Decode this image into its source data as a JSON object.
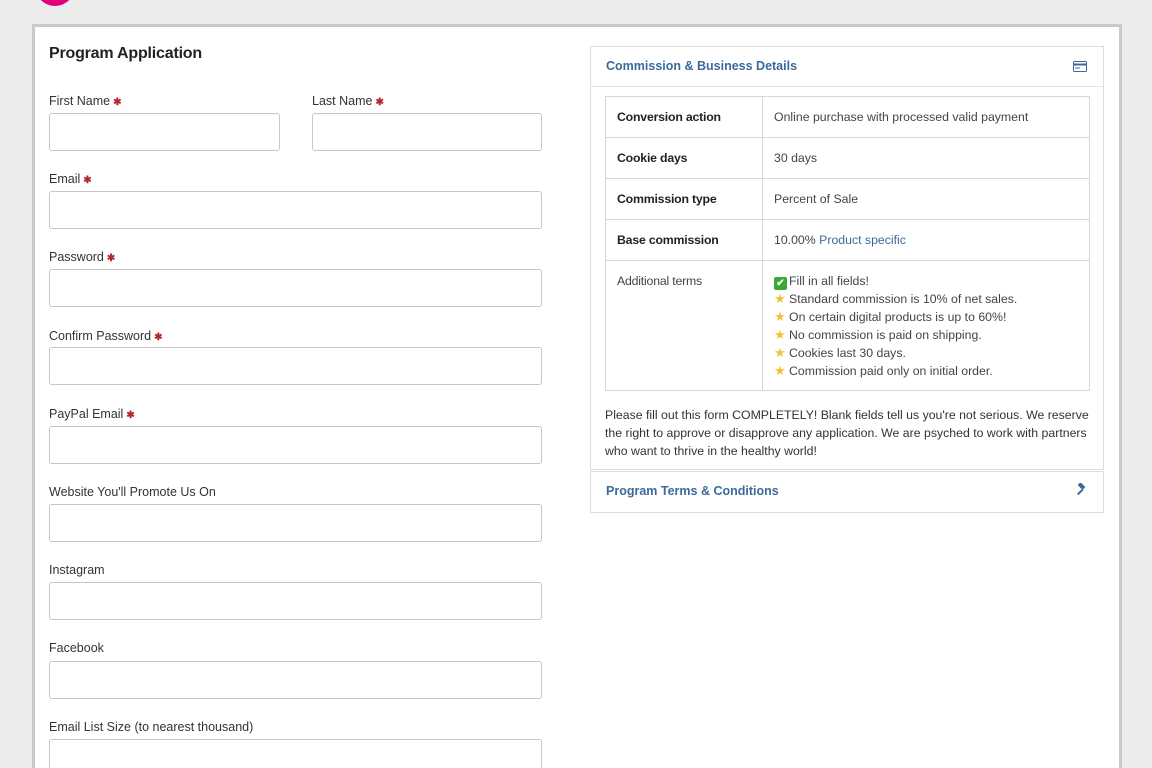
{
  "form": {
    "title": "Program Application",
    "fields": {
      "first_name": {
        "label": "First Name",
        "required_mark": "✱",
        "value": ""
      },
      "last_name": {
        "label": "Last Name",
        "required_mark": "✱",
        "value": ""
      },
      "email": {
        "label": "Email",
        "required_mark": "✱",
        "value": ""
      },
      "password": {
        "label": "Password",
        "required_mark": "✱",
        "value": ""
      },
      "confirm_password": {
        "label": "Confirm Password",
        "required_mark": "✱",
        "value": ""
      },
      "paypal_email": {
        "label": "PayPal Email",
        "required_mark": "✱",
        "value": ""
      },
      "website": {
        "label": "Website You'll Promote Us On",
        "value": ""
      },
      "instagram": {
        "label": "Instagram",
        "value": ""
      },
      "facebook": {
        "label": "Facebook",
        "value": ""
      },
      "email_list_size": {
        "label": "Email List Size (to nearest thousand)",
        "value": ""
      }
    }
  },
  "commission_panel": {
    "title": "Commission & Business Details",
    "icon": "credit-card-icon",
    "rows": [
      {
        "key": "Conversion action",
        "value": "Online purchase with processed valid payment"
      },
      {
        "key": "Cookie days",
        "value": "30 days"
      },
      {
        "key": "Commission type",
        "value": "Percent of Sale"
      },
      {
        "key": "Base commission",
        "value": "10.00%",
        "link": "Product specific"
      }
    ],
    "additional_terms": {
      "key": "Additional terms",
      "lines": [
        {
          "icon": "check-mark-icon",
          "glyph": "✔",
          "text": "Fill in all fields!"
        },
        {
          "icon": "star-icon",
          "glyph": "★",
          "text": "Standard commission is 10% of net sales."
        },
        {
          "icon": "star-icon",
          "glyph": "★",
          "text": "On certain digital products is up to 60%!"
        },
        {
          "icon": "star-icon",
          "glyph": "★",
          "text": "No commission is paid on shipping."
        },
        {
          "icon": "star-icon",
          "glyph": "★",
          "text": "Cookies last 30 days."
        },
        {
          "icon": "star-icon",
          "glyph": "★",
          "text": "Commission paid only on initial order."
        }
      ]
    },
    "note": "Please fill out this form COMPLETELY!  Blank fields tell us you're not serious.  We reserve the right to approve or disapprove any application.  We are psyched to work with partners who want to thrive in the healthy world!"
  },
  "terms_panel": {
    "title": "Program Terms & Conditions",
    "icon": "gavel-icon"
  },
  "colors": {
    "accent": "#3b6a9a",
    "required": "#b3262c",
    "brand": "#e0007a",
    "check": "#3aa935",
    "star": "#f2c230"
  }
}
